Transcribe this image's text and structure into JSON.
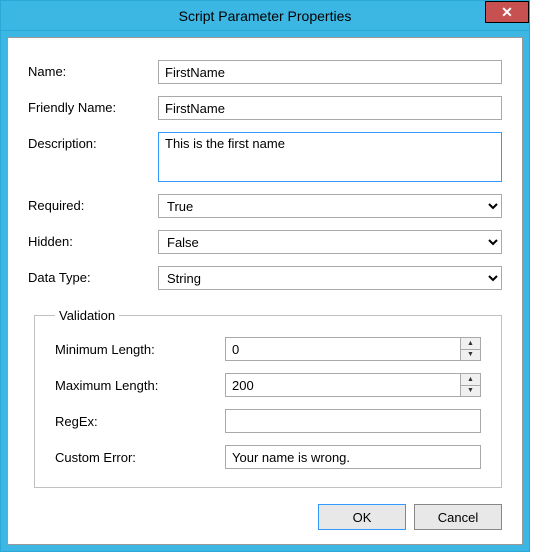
{
  "title": "Script Parameter Properties",
  "close_glyph": "✕",
  "fields": {
    "name": {
      "label": "Name:",
      "value": "FirstName"
    },
    "friendly": {
      "label": "Friendly Name:",
      "value": "FirstName"
    },
    "description": {
      "label": "Description:",
      "value": "This is the first name"
    },
    "required": {
      "label": "Required:",
      "value": "True"
    },
    "hidden": {
      "label": "Hidden:",
      "value": "False"
    },
    "datatype": {
      "label": "Data Type:",
      "value": "String"
    }
  },
  "validation": {
    "legend": "Validation",
    "min": {
      "label": "Minimum Length:",
      "value": "0"
    },
    "max": {
      "label": "Maximum Length:",
      "value": "200"
    },
    "regex": {
      "label": "RegEx:",
      "value": ""
    },
    "error": {
      "label": "Custom Error:",
      "value": "Your name is wrong."
    }
  },
  "buttons": {
    "ok": "OK",
    "cancel": "Cancel"
  }
}
